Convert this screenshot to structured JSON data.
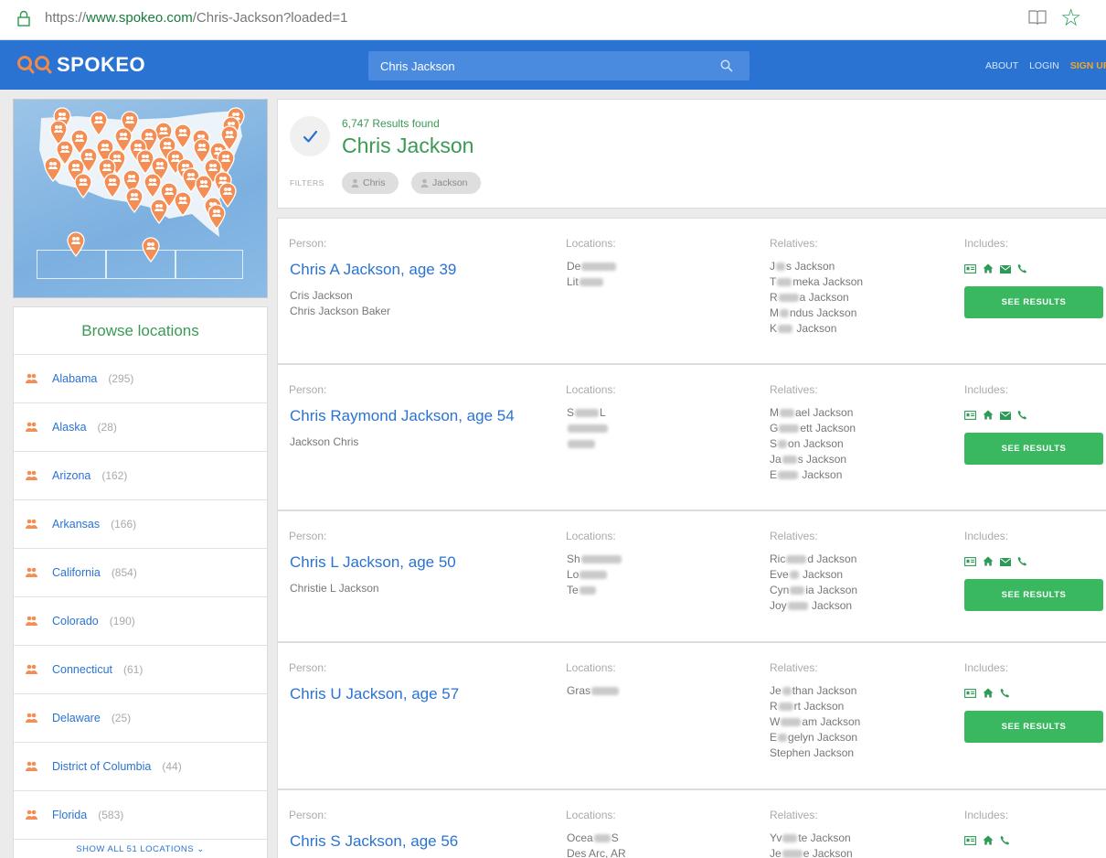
{
  "browser": {
    "url_prefix": "https://",
    "url_domain": "www.spokeo.com",
    "url_path": "/Chris-Jackson?loaded=1"
  },
  "nav": {
    "logo_text": "SPOKEO",
    "search_value": "Chris Jackson",
    "links": {
      "about": "ABOUT",
      "login": "LOGIN",
      "signup": "SIGN UP"
    },
    "colors": {
      "nav_bg": "#2a73d2",
      "accent_green": "#3ab860",
      "signup_orange": "#f5a623"
    }
  },
  "results_header": {
    "count": "6,747 Results found",
    "name": "Chris Jackson",
    "filters_label": "FILTERS",
    "filters": [
      "Chris",
      "Jackson"
    ]
  },
  "labels": {
    "person": "Person:",
    "locations": "Locations:",
    "relatives": "Relatives:",
    "includes": "Includes:",
    "see_results": "SEE RESULTS"
  },
  "browse": {
    "title": "Browse locations",
    "show_all": "SHOW ALL 51 LOCATIONS",
    "states": [
      {
        "name": "Alabama",
        "count": "(295)"
      },
      {
        "name": "Alaska",
        "count": "(28)"
      },
      {
        "name": "Arizona",
        "count": "(162)"
      },
      {
        "name": "Arkansas",
        "count": "(166)"
      },
      {
        "name": "California",
        "count": "(854)"
      },
      {
        "name": "Colorado",
        "count": "(190)"
      },
      {
        "name": "Connecticut",
        "count": "(61)"
      },
      {
        "name": "Delaware",
        "count": "(25)"
      },
      {
        "name": "District of Columbia",
        "count": "(44)"
      },
      {
        "name": "Florida",
        "count": "(583)"
      }
    ]
  },
  "results": [
    {
      "name": "Chris A Jackson, age 39",
      "aliases": [
        "Cris Jackson",
        "Chris Jackson Baker"
      ],
      "locations": [
        [
          "De",
          ""
        ],
        [
          "Lit",
          ""
        ]
      ],
      "relatives": [
        [
          "J",
          "s Jackson"
        ],
        [
          "T",
          "meka Jackson"
        ],
        [
          "R",
          "a Jackson"
        ],
        [
          "M",
          "ndus Jackson"
        ],
        [
          "K",
          " Jackson"
        ]
      ],
      "includes": [
        "id-card-icon",
        "home-icon",
        "email-icon",
        "phone-icon"
      ]
    },
    {
      "name": "Chris Raymond Jackson, age 54",
      "aliases": [
        "Jackson Chris"
      ],
      "locations": [
        [
          "S",
          "L"
        ],
        [
          "",
          ""
        ],
        [
          "",
          ""
        ]
      ],
      "relatives": [
        [
          "M",
          "ael Jackson"
        ],
        [
          "G",
          "ett Jackson"
        ],
        [
          "S",
          "on Jackson"
        ],
        [
          "Ja",
          "s Jackson"
        ],
        [
          "E",
          " Jackson"
        ]
      ],
      "includes": [
        "id-card-icon",
        "home-icon",
        "email-icon",
        "phone-icon"
      ]
    },
    {
      "name": "Chris L Jackson, age 50",
      "aliases": [
        "Christie L Jackson"
      ],
      "locations": [
        [
          "Sh",
          ""
        ],
        [
          "Lo",
          ""
        ],
        [
          "Te",
          ""
        ]
      ],
      "relatives": [
        [
          "Ric",
          "d Jackson"
        ],
        [
          "Eve",
          " Jackson"
        ],
        [
          "Cyn",
          "ia Jackson"
        ],
        [
          "Joy",
          " Jackson"
        ]
      ],
      "includes": [
        "id-card-icon",
        "home-icon",
        "email-icon",
        "phone-icon"
      ]
    },
    {
      "name": "Chris U Jackson, age 57",
      "aliases": [],
      "locations": [
        [
          "Gras",
          ""
        ]
      ],
      "relatives": [
        [
          "Je",
          "than Jackson"
        ],
        [
          "R",
          "rt Jackson"
        ],
        [
          "W",
          "am Jackson"
        ],
        [
          "E",
          "gelyn Jackson"
        ],
        [
          "Stephen Jackson",
          ""
        ]
      ],
      "includes": [
        "id-card-icon",
        "home-icon",
        "phone-icon"
      ]
    },
    {
      "name": "Chris S Jackson, age 56",
      "aliases": [],
      "locations": [
        [
          "Ocea",
          "S"
        ],
        [
          "Des Arc, AR",
          ""
        ]
      ],
      "relatives": [
        [
          "Yv",
          "te Jackson"
        ],
        [
          "Je",
          "e Jackson"
        ]
      ],
      "includes": [
        "id-card-icon",
        "home-icon",
        "phone-icon"
      ]
    }
  ]
}
